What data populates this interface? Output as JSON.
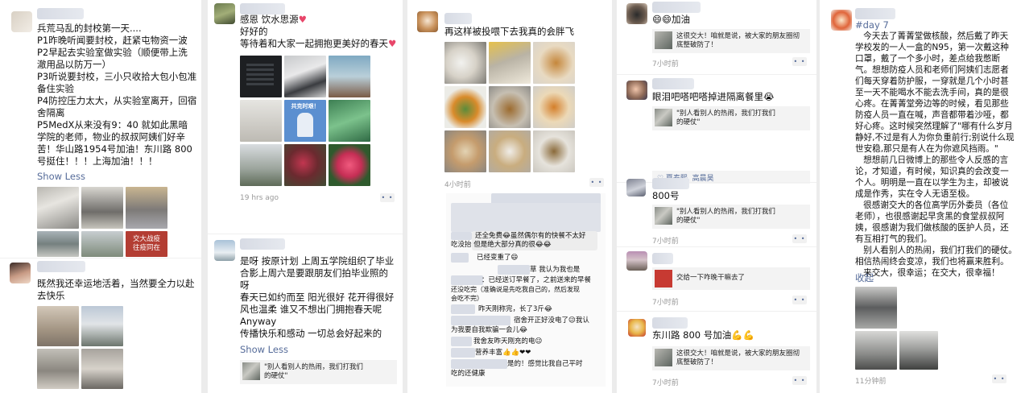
{
  "columns": [
    {
      "post1_text": "兵荒马乱的封校第一天....\nP1昨晚听闻要封校，赶紧屯物资一波\nP2早起去实验室做实验（顺便带上洗\n澈用品以防万一）\nP3听说要封校，三小只收拾大包小包准\n备住实验\nP4防控压力太大，从实验室离开，回宿\n舍隔离\nP5MedX从来没有9：40 就如此黑暗\n学院的老师，物业的叔叔阿姨们好辛\n苦！华山路1954号加油！东川路 800\n号挺住！！！上海加油！！！",
      "post1_show_less": "Show Less",
      "post1_stamp": "交大战疫\n往疫同在",
      "post2_text": "既然我还幸运地活着，当然要全力以赴\n去快乐"
    },
    {
      "post1_text": "感恩 饮水思源",
      "post1_line2": "好好的",
      "post1_line3": "等待着和大家一起拥抱更美好的春天",
      "post1_sign": "共克时艰！",
      "post1_time": "19 hrs ago",
      "post2_text": "是呀 按原计划 上周五学院组织了毕业\n合影上周六是要跟朋友们拍毕业照的\n呀\n春天已如约而至 阳光很好 花开得很好\n风也温柔 谁又不想出门拥抱春天呢\nAnyway\n传播快乐和感动 一切总会好起来的",
      "post2_show_less": "Show Less",
      "post2_share": "\"别人看别人的热闹，我们打我们\n的硬仗\""
    },
    {
      "post1_text": "再这样被投喂下去我真的会胖飞",
      "post1_time": "4小时前",
      "chat_lines": [
        "还全免费😂虽然偶尔有的快餐不太好",
        "吃没抬 但是绝大部分真的很😂😂",
        "已经变重了😄",
        "草 我认为我也是",
        "：已经送订早餐了，之前送来的早餐",
        "还没吃完（准确说是先吃我自己的，然后发现",
        "会吃不完）",
        "昨天刚称完，长了3斤😂",
        "宿舍开正好没电了😉我认",
        "为我要自我欺骗一会儿😂",
        "我舍友昨天刚充的电😉",
        "营养丰富👍👍❤❤",
        "是的！感觉比我自己平时",
        "吃的还健康"
      ]
    },
    {
      "post1_text": "😄😄加油",
      "post1_share": "这很交大！咱就是说，被大家的朋友圈彻\n底整破防了！",
      "post1_time": "7小时前",
      "post2_text": "眼泪吧嗒吧嗒掉进隔离餐里😭",
      "post2_share": "\"别人看别人的热闹，我们打我们\n的硬仗\"",
      "post2_likes": "♡ 夏泰熙, 高晨昊",
      "post3_text": "800号",
      "post3_share": "\"别人看别人的热闹，我们打我们\n的硬仗\"",
      "post3_time": "7小时前",
      "post4_share": "交给一下咋晚干嘛去了",
      "post4_time": "7小时前",
      "post5_text": "东川路 800 号加油💪💪",
      "post5_share": "这很交大！咱就是说，被大家的朋友圈彻\n底整破防了！",
      "post5_time": "7小时前"
    },
    {
      "hashtag": "#day 7",
      "post_text": "   今天去了菁菁堂做核酸，然后戴了昨天\n学校发的一人一盒的N95，第一次戴这种\n口罩，戴了一个多小时，差点给我憋断\n气。想想防疫人员和老师们阿姨们志愿者\n们每天穿着防护服，一穿就是几个小时甚\n至一天不能喝水不能去洗手间，真的是很\n心疼。在菁菁堂旁边等的时候，看见那些\n防疫人员一直在喊，声音都带着沙哑，都\n好心疼。这时候突然理解了\"哪有什么岁月\n静好,不过是有人为你负重前行;别说什么现\n世安稳,那只是有人在为你遮风挡雨。\"\n   想想前几日微博上的那些令人反感的言\n论，才知道，有时候，知识真的会改变一\n个人。明明是一直在以学生为主，却被说\n成是作秀，实在令人无语至极。\n   很感谢交大的各位高学历外委员（各位\n老师），也很感谢起早贪黑的食堂叔叔阿\n姨，很感谢为我们做核酸的医护人员，还\n有互相打气的我们。\n   别人看别人的热闹，我们打我们的硬仗。\n相信热闹终会变凉，我们也将赢来胜利。\n   来交大，很幸运；在交大，很幸福！",
      "collapse": "收起",
      "time": "11分钟前"
    }
  ],
  "ui": {
    "more_dots": "• •"
  }
}
